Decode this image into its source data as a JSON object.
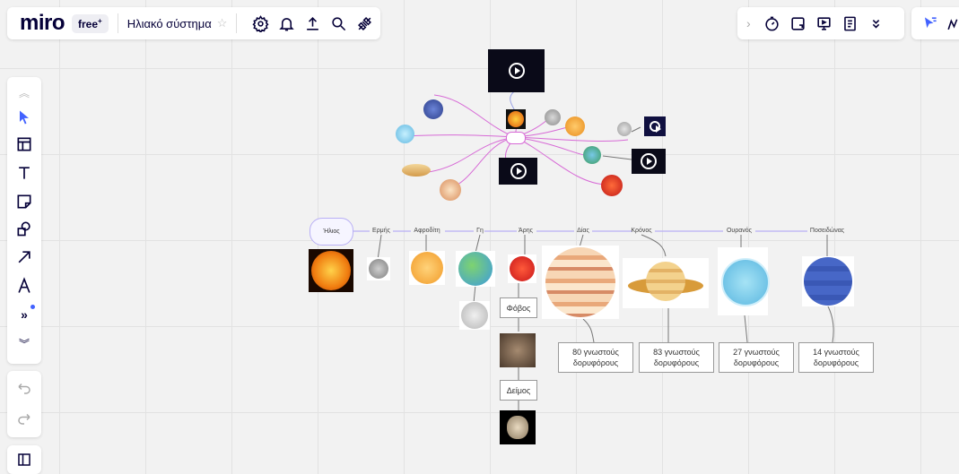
{
  "header": {
    "logo": "miro",
    "plan_badge": "free",
    "plan_badge_sup": "+",
    "board_name": "Ηλιακό σύστημα"
  },
  "right_toolbar": {
    "chevron": "›"
  },
  "mindmap": {
    "center": "Ήλιος",
    "branches": [
      "Ερμής",
      "Αφροδίτη",
      "Γη",
      "Άρης",
      "Δίας",
      "Κρόνος",
      "Ουρανός",
      "Ποσειδώνας"
    ]
  },
  "notes": {
    "phobos": "Φόβος",
    "deimos": "Δείμος",
    "jupiter_moons": "80 γνωστούς δορυφόρους",
    "saturn_moons": "83 γνωστούς δορυφόρους",
    "uranus_moons": "27 γνωστούς δορυφόρους",
    "neptune_moons": "14 γνωστούς δορυφόρους"
  },
  "colors": {
    "accent": "#4262ff",
    "connector": "#b9b0f5",
    "sun": "#f07d10",
    "toolbar_dot": "#4262ff"
  },
  "icons": [
    "settings-icon",
    "bell-icon",
    "upload-icon",
    "search-icon",
    "plug-icon",
    "timer-icon",
    "share-screen-icon",
    "present-icon",
    "notes-icon",
    "more-icon",
    "cursor-icon",
    "frame-icon",
    "text-icon",
    "sticky-note-icon",
    "shapes-icon",
    "arrow-icon",
    "pen-icon",
    "more-tools-icon",
    "collapse-icon",
    "undo-icon",
    "redo-icon",
    "panel-icon"
  ]
}
